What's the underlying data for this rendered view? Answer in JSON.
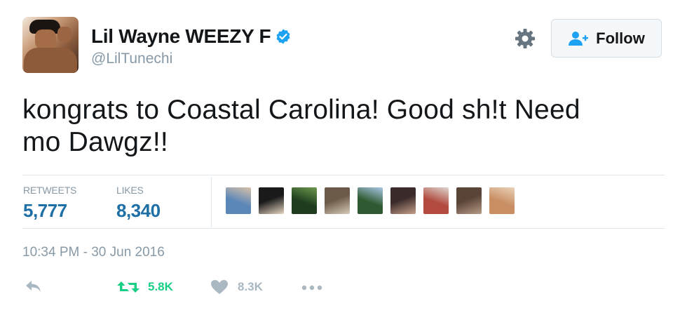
{
  "user": {
    "display_name": "Lil Wayne WEEZY F",
    "handle": "@LilTunechi"
  },
  "header": {
    "follow_label": "Follow"
  },
  "tweet": {
    "text_line1": "kongrats to Coastal Carolina! Good sh!t  Need",
    "text_line2": "mo Dawgz!!"
  },
  "stats": {
    "retweets_label": "RETWEETS",
    "retweets_value": "5,777",
    "likes_label": "LIKES",
    "likes_value": "8,340"
  },
  "likers": [
    {
      "icon": "liker-avatar-1",
      "colors": [
        "#5b86b8",
        "#d9c2a8"
      ]
    },
    {
      "icon": "liker-avatar-2",
      "colors": [
        "#1a1a1a",
        "#e8d7c3"
      ]
    },
    {
      "icon": "liker-avatar-3",
      "colors": [
        "#1f3d1e",
        "#6e9a4e"
      ]
    },
    {
      "icon": "liker-avatar-4",
      "colors": [
        "#6b5a48",
        "#d8cbb8"
      ]
    },
    {
      "icon": "liker-avatar-5",
      "colors": [
        "#2f5a31",
        "#a8c8e6"
      ]
    },
    {
      "icon": "liker-avatar-6",
      "colors": [
        "#3a2a2a",
        "#c7a08a"
      ]
    },
    {
      "icon": "liker-avatar-7",
      "colors": [
        "#b24a3e",
        "#ddd6cf"
      ]
    },
    {
      "icon": "liker-avatar-8",
      "colors": [
        "#5a4438",
        "#b69a86"
      ]
    },
    {
      "icon": "liker-avatar-9",
      "colors": [
        "#c98e63",
        "#e9d2b8"
      ]
    }
  ],
  "meta": {
    "timestamp": "10:34 PM - 30 Jun 2016"
  },
  "actions": {
    "retweet_count": "5.8K",
    "like_count": "8.3K"
  },
  "colors": {
    "retweet_green": "#19cf86",
    "muted": "#aab8c2",
    "verified_blue": "#1da1f2"
  }
}
